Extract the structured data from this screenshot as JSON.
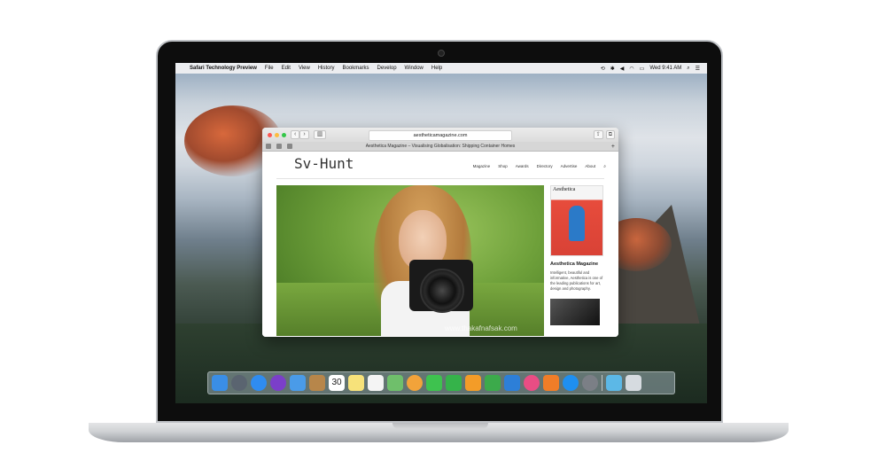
{
  "menubar": {
    "app_name": "Safari Technology Preview",
    "menus": [
      "File",
      "Edit",
      "View",
      "History",
      "Bookmarks",
      "Develop",
      "Window",
      "Help"
    ],
    "clock": "Wed 9:41 AM"
  },
  "safari": {
    "address": "aestheticamagazine.com",
    "tab_title": "Aesthetica Magazine – Visualising Globalisation: Shipping Container Homes"
  },
  "webpage": {
    "brand": "Sv-Hunt",
    "nav": [
      "Magazine",
      "Shop",
      "Awards",
      "Directory",
      "Advertise",
      "About"
    ],
    "watermark": "www.thakafnafsak.com",
    "sidebar": {
      "cover_title": "Aesthetica",
      "title": "Aesthetica Magazine",
      "text": "Intelligent, beautiful and informative, Aesthetica is one of the leading publications for art, design and photography."
    }
  },
  "dock": {
    "calendar_day": "30",
    "icons": [
      "finder-icon",
      "launchpad-icon",
      "safari-icon",
      "safari-tp-icon",
      "mail-icon",
      "contacts-icon",
      "calendar-icon",
      "notes-icon",
      "reminders-icon",
      "maps-icon",
      "photos-icon",
      "messages-icon",
      "facetime-icon",
      "pages-icon",
      "numbers-icon",
      "keynote-icon",
      "itunes-icon",
      "ibooks-icon",
      "app-store-icon",
      "system-preferences-icon",
      "downloads-icon",
      "trash-icon"
    ],
    "colors": {
      "finder-icon": "#3a8ee6",
      "launchpad-icon": "#5a6470",
      "safari-icon": "#2f8cf0",
      "safari-tp-icon": "#7b3fc9",
      "mail-icon": "#4a9be8",
      "contacts-icon": "#b7864a",
      "notes-icon": "#f7e27a",
      "reminders-icon": "#f4f4f4",
      "maps-icon": "#6fbf6b",
      "photos-icon": "#f2a33a",
      "messages-icon": "#3ec24f",
      "facetime-icon": "#35b34a",
      "pages-icon": "#f39c28",
      "numbers-icon": "#3caa4b",
      "keynote-icon": "#2d7fd8",
      "itunes-icon": "#e94d84",
      "ibooks-icon": "#f07d28",
      "app-store-icon": "#1f8ff0",
      "system-preferences-icon": "#7b7f86",
      "downloads-icon": "#5cb8e6",
      "trash-icon": "#d6dbe0"
    }
  }
}
